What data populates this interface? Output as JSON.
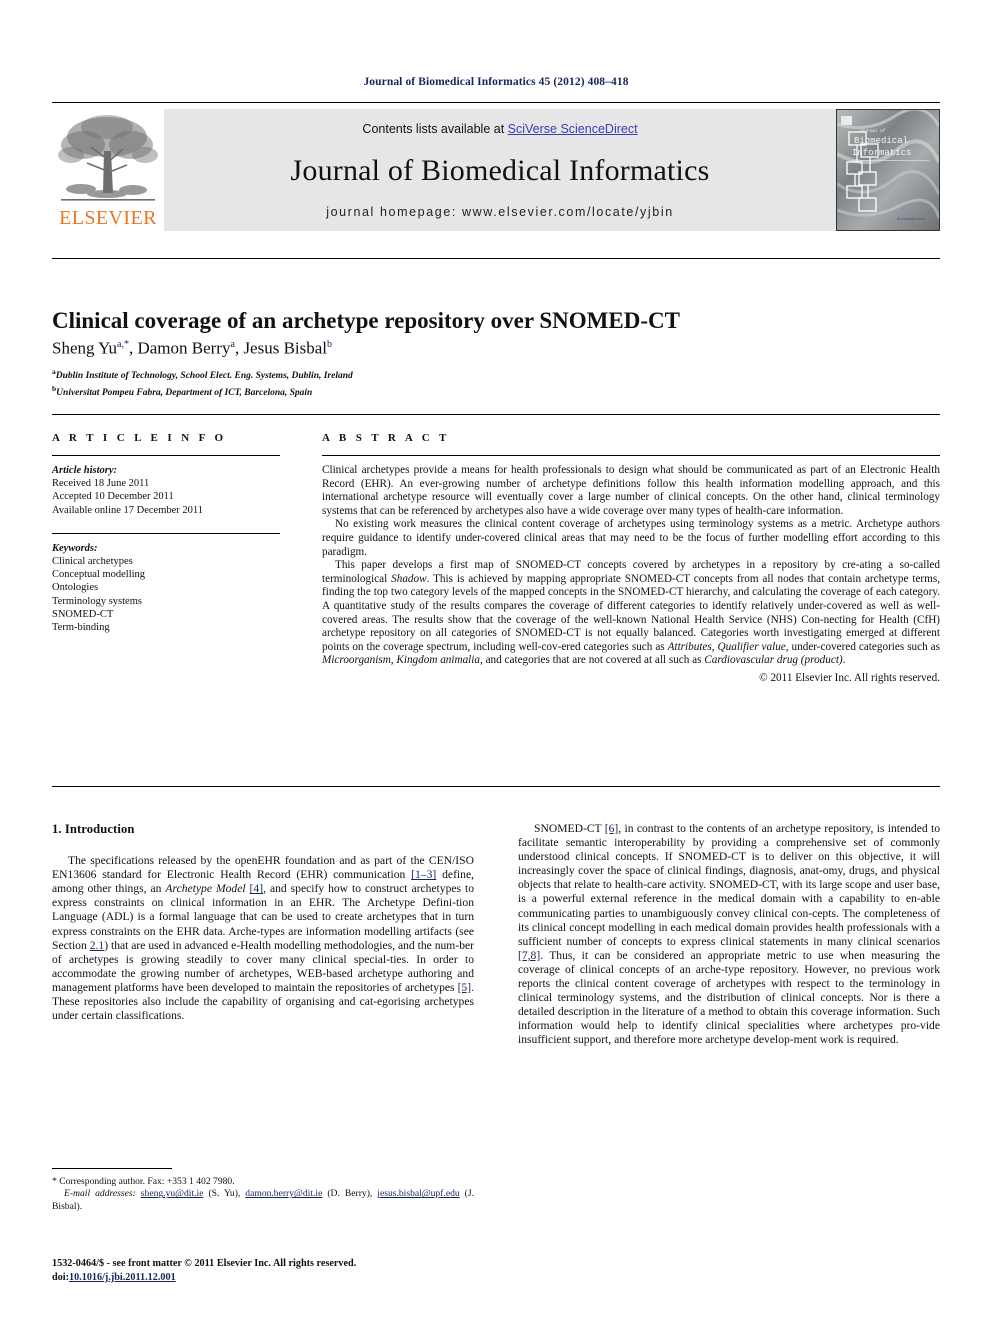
{
  "running_head": "Journal of Biomedical Informatics 45 (2012) 408–418",
  "masthead": {
    "contents_prefix": "Contents lists available at ",
    "sciencedirect_link": "SciVerse ScienceDirect",
    "journal_title": "Journal of Biomedical Informatics",
    "homepage": "journal homepage: www.elsevier.com/locate/yjbin",
    "publisher_wordmark": "ELSEVIER",
    "publisher_color": "#e87722",
    "link_color": "#3b3bb5",
    "cover_title_line1": "Journal of",
    "cover_title_line2": "Biomedical",
    "cover_title_line3": "Informatics"
  },
  "article": {
    "title": "Clinical coverage of an archetype repository over SNOMED-CT",
    "authors": "Sheng Yu, Damon Berry, Jesus Bisbal",
    "author_list": [
      {
        "name": "Sheng Yu",
        "marks": "a,*"
      },
      {
        "name": "Damon Berry",
        "marks": "a"
      },
      {
        "name": "Jesus Bisbal",
        "marks": "b"
      }
    ],
    "affiliations": [
      {
        "mark": "a",
        "text": "Dublin Institute of Technology, School Elect. Eng. Systems, Dublin, Ireland"
      },
      {
        "mark": "b",
        "text": "Universitat Pompeu Fabra, Department of ICT, Barcelona, Spain"
      }
    ]
  },
  "info": {
    "heading": "A R T I C L E  I N F O",
    "history_label": "Article history:",
    "history": [
      "Received 18 June 2011",
      "Accepted 10 December 2011",
      "Available online 17 December 2011"
    ],
    "keywords_label": "Keywords:",
    "keywords": [
      "Clinical archetypes",
      "Conceptual modelling",
      "Ontologies",
      "Terminology systems",
      "SNOMED-CT",
      "Term-binding"
    ]
  },
  "abstract": {
    "heading": "A B S T R A C T",
    "paragraphs": [
      "Clinical archetypes provide a means for health professionals to design what should be communicated as part of an Electronic Health Record (EHR). An ever-growing number of archetype definitions follow this health information modelling approach, and this international archetype resource will eventually cover a large number of clinical concepts. On the other hand, clinical terminology systems that can be referenced by archetypes also have a wide coverage over many types of health-care information.",
      "No existing work measures the clinical content coverage of archetypes using terminology systems as a metric. Archetype authors require guidance to identify under-covered clinical areas that may need to be the focus of further modelling effort according to this paradigm."
    ],
    "paragraph3_parts": [
      {
        "t": "This paper develops a first map of SNOMED-CT concepts covered by archetypes in a repository by cre-ating a so-called terminological ",
        "i": false
      },
      {
        "t": "Shadow",
        "i": true
      },
      {
        "t": ". This is achieved by mapping appropriate SNOMED-CT concepts from all nodes that contain archetype terms, finding the top two category levels of the mapped concepts in the SNOMED-CT hierarchy, and calculating the coverage of each category. A quantitative study of the results compares the coverage of different categories to identify relatively under-covered as well as well-covered areas. The results show that the coverage of the well-known National Health Service (NHS) Con-necting for Health (CfH) archetype repository on all categories of SNOMED-CT is not equally balanced. Categories worth investigating emerged at different points on the coverage spectrum, including well-cov-ered categories such as ",
        "i": false
      },
      {
        "t": "Attributes",
        "i": true
      },
      {
        "t": ", ",
        "i": false
      },
      {
        "t": "Qualifier value",
        "i": true
      },
      {
        "t": ", under-covered categories such as ",
        "i": false
      },
      {
        "t": "Microorganism",
        "i": true
      },
      {
        "t": ", ",
        "i": false
      },
      {
        "t": "Kingdom animalia",
        "i": true
      },
      {
        "t": ", and categories that are not covered at all such as ",
        "i": false
      },
      {
        "t": "Cardiovascular drug (product)",
        "i": true
      },
      {
        "t": ".",
        "i": false
      }
    ],
    "copyright": "© 2011 Elsevier Inc. All rights reserved."
  },
  "introduction": {
    "heading": "1. Introduction",
    "left_parts": [
      {
        "t": "The specifications released by the openEHR foundation and as part of the CEN/ISO EN13606 standard for Electronic Health Record (EHR) communication ",
        "style": "plain"
      },
      {
        "t": "[1–3]",
        "style": "ref"
      },
      {
        "t": " define, among other things, an ",
        "style": "plain"
      },
      {
        "t": "Archetype Model",
        "style": "italic"
      },
      {
        "t": " ",
        "style": "plain"
      },
      {
        "t": "[4]",
        "style": "ref"
      },
      {
        "t": ", and specify how to construct archetypes to express constraints on clinical information in an EHR. The Archetype Defini-tion Language (ADL) is a formal language that can be used to create archetypes that in turn express constraints on the EHR data. Arche-types are information modelling artifacts (see Section ",
        "style": "plain"
      },
      {
        "t": "2.1",
        "style": "ref"
      },
      {
        "t": ") that are used in advanced e-Health modelling methodologies, and the num-ber of archetypes is growing steadily to cover many clinical special-ties. In order to accommodate the growing number of archetypes, WEB-based archetype authoring and management platforms have been developed to maintain the repositories of archetypes ",
        "style": "plain"
      },
      {
        "t": "[5]",
        "style": "ref"
      },
      {
        "t": ". These repositories also include the capability of organising and cat-egorising archetypes under certain classifications.",
        "style": "plain"
      }
    ],
    "right_parts": [
      {
        "t": "SNOMED-CT ",
        "style": "plain"
      },
      {
        "t": "[6]",
        "style": "ref"
      },
      {
        "t": ", in contrast to the contents of an archetype repository, is intended to facilitate semantic interoperability by providing a comprehensive set of commonly understood clinical concepts. If SNOMED-CT is to deliver on this objective, it will increasingly cover the space of clinical findings, diagnosis, anat-omy, drugs, and physical objects that relate to health-care activity. SNOMED-CT, with its large scope and user base, is a powerful external reference in the medical domain with a capability to en-able communicating parties to unambiguously convey clinical con-cepts. The completeness of its clinical concept modelling in each medical domain provides health professionals with a sufficient number of concepts to express clinical statements in many clinical scenarios ",
        "style": "plain"
      },
      {
        "t": "[7,8]",
        "style": "ref"
      },
      {
        "t": ". Thus, it can be considered an appropriate metric to use when measuring the coverage of clinical concepts of an arche-type repository. However, no previous work reports the clinical content coverage of archetypes with respect to the terminology in clinical terminology systems, and the distribution of clinical concepts. Nor is there a detailed description in the literature of a method to obtain this coverage information. Such information would help to identify clinical specialities where archetypes pro-vide insufficient support, and therefore more archetype develop-ment work is required.",
        "style": "plain"
      }
    ]
  },
  "footnotes": {
    "corresponding": "* Corresponding author. Fax: +353 1 402 7980.",
    "email_label": "E-mail addresses:",
    "emails": [
      {
        "address": "sheng.yu@dit.ie",
        "person": " (S. Yu), "
      },
      {
        "address": "damon.berry@dit.ie",
        "person": " (D. Berry), "
      },
      {
        "address": "jesus.bisbal@upf.edu",
        "person": " (J. Bisbal)."
      }
    ]
  },
  "imprint": {
    "issn_line": "1532-0464/$ - see front matter © 2011 Elsevier Inc. All rights reserved.",
    "doi_label": "doi:",
    "doi_value": "10.1016/j.jbi.2011.12.001"
  }
}
